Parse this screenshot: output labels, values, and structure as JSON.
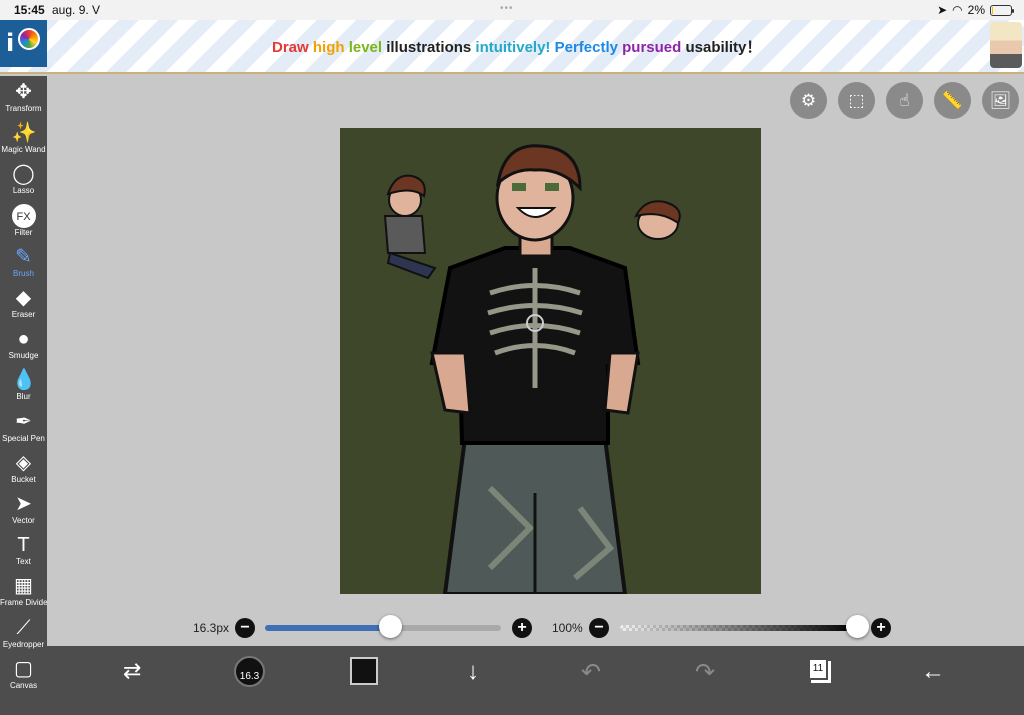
{
  "status_bar": {
    "time": "15:45",
    "date": "aug. 9. V",
    "battery": "2%",
    "battery_level": 0.02
  },
  "banner": {
    "tagline": [
      {
        "text": "Draw ",
        "color": "#e53935"
      },
      {
        "text": "high ",
        "color": "#f2a100"
      },
      {
        "text": "level ",
        "color": "#7cb518"
      },
      {
        "text": "illustrations ",
        "color": "#222222"
      },
      {
        "text": "intuitively! ",
        "color": "#26a9c9"
      },
      {
        "text": "Perfectly ",
        "color": "#1e88e5"
      },
      {
        "text": "pursued ",
        "color": "#8e24aa"
      },
      {
        "text": "usability",
        "color": "#222222"
      },
      {
        "text": "！",
        "color": "#222222"
      }
    ]
  },
  "toolbar": {
    "tools": [
      {
        "label": "Transform",
        "icon": "move-arrows-icon",
        "glyph": "✥",
        "active": false
      },
      {
        "label": "Magic Wand",
        "icon": "magic-wand-icon",
        "glyph": "✨",
        "active": false
      },
      {
        "label": "Lasso",
        "icon": "lasso-icon",
        "glyph": "◯",
        "active": false
      },
      {
        "label": "Filter",
        "icon": "fx-filter-icon",
        "glyph": "FX",
        "active": false
      },
      {
        "label": "Brush",
        "icon": "brush-icon",
        "glyph": "✎",
        "active": true
      },
      {
        "label": "Eraser",
        "icon": "eraser-icon",
        "glyph": "◆",
        "active": false
      },
      {
        "label": "Smudge",
        "icon": "smudge-icon",
        "glyph": "●",
        "active": false
      },
      {
        "label": "Blur",
        "icon": "blur-drop-icon",
        "glyph": "💧",
        "active": false
      },
      {
        "label": "Special Pen",
        "icon": "special-pen-icon",
        "glyph": "✒",
        "active": false
      },
      {
        "label": "Bucket",
        "icon": "bucket-icon",
        "glyph": "◈",
        "active": false
      },
      {
        "label": "Vector",
        "icon": "vector-cursor-icon",
        "glyph": "➤",
        "active": false
      },
      {
        "label": "Text",
        "icon": "text-icon",
        "glyph": "T",
        "active": false
      },
      {
        "label": "Frame Divider",
        "icon": "frame-divider-icon",
        "glyph": "▦",
        "active": false
      },
      {
        "label": "Eyedropper",
        "icon": "eyedropper-icon",
        "glyph": "⟋",
        "active": false
      },
      {
        "label": "Canvas",
        "icon": "canvas-icon",
        "glyph": "▢",
        "active": false
      }
    ]
  },
  "top_buttons": [
    {
      "name": "toggle-icon",
      "glyph": "⚙"
    },
    {
      "name": "selection-icon",
      "glyph": "⬚"
    },
    {
      "name": "hand-touch-icon",
      "glyph": "☝"
    },
    {
      "name": "ruler-icon",
      "glyph": "📏"
    },
    {
      "name": "image-material-icon",
      "glyph": "🖼"
    }
  ],
  "brush_controls": {
    "size_label": "16.3px",
    "size_level": 0.53,
    "opacity_label": "100%",
    "opacity_level": 1.0
  },
  "bottom_bar": {
    "brush_size_badge": "16.3",
    "layer_count": "11",
    "primary_color": "#111111"
  },
  "colors": {
    "toolbar_bg": "#4d4d4d",
    "canvas_bg": "#3e472a",
    "accent": "#3f6fb5"
  }
}
